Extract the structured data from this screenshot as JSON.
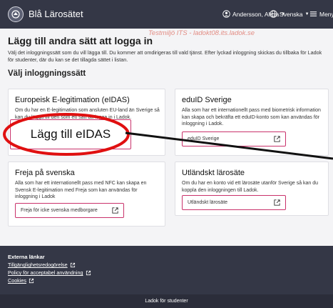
{
  "header": {
    "brand": "Blå Lärosätet",
    "user": "Andersson, Alicia",
    "language": "Svenska",
    "menu": "Meny"
  },
  "watermark": "Testmiljö ITS - ladokt08.its.ladok.se",
  "page": {
    "title": "Lägg till andra sätt att logga in",
    "intro": "Välj det inloggningssätt som du vill lägga till. Du kommer att omdirigeras till vald tjänst. Efter lyckad inloggning skickas du tillbaka för Ladok för studenter, där du kan se det tillagda sättet i listan.",
    "section_title": "Välj inloggningssätt"
  },
  "cards": {
    "eidas": {
      "title": "Europeisk E-legitimation (eIDAS)",
      "desc": "Om du har en E-legitimation som ansluten EU-land än Sverige så kan du lägga till den som ett sätt att logga in i Ladok.",
      "button": "Lägg till eIDAS"
    },
    "eduid": {
      "title": "eduID Sverige",
      "desc": "Alla som har ett internationellt pass med biometrisk information kan skapa och bekräfta ett eduID-konto som kan användas för inloggning i Ladok.",
      "button": "eduID Sverige"
    },
    "freja": {
      "title": "Freja på svenska",
      "desc": "Alla som har ett internationellt pass med NFC kan skapa en Svensk E-legitimation med Freja som kan användas för inloggning i Ladok",
      "button": "Freja för icke svenska medborgare"
    },
    "foreign": {
      "title": "Utländskt lärosäte",
      "desc": "Om du har en konto vid ett lärosäte utanför Sverige så kan du koppla den inloggningen till Ladok.",
      "button": "Utländskt lärosäte"
    }
  },
  "footer": {
    "heading": "Externa länkar",
    "links": [
      "Tillgänglighetsredogörelse",
      "Policy för acceptabel användning",
      "Cookies"
    ],
    "bottom": "Ladok för studenter"
  },
  "colors": {
    "header_bg": "#343746",
    "accent": "#c9326b",
    "annotation": "#e01010"
  }
}
